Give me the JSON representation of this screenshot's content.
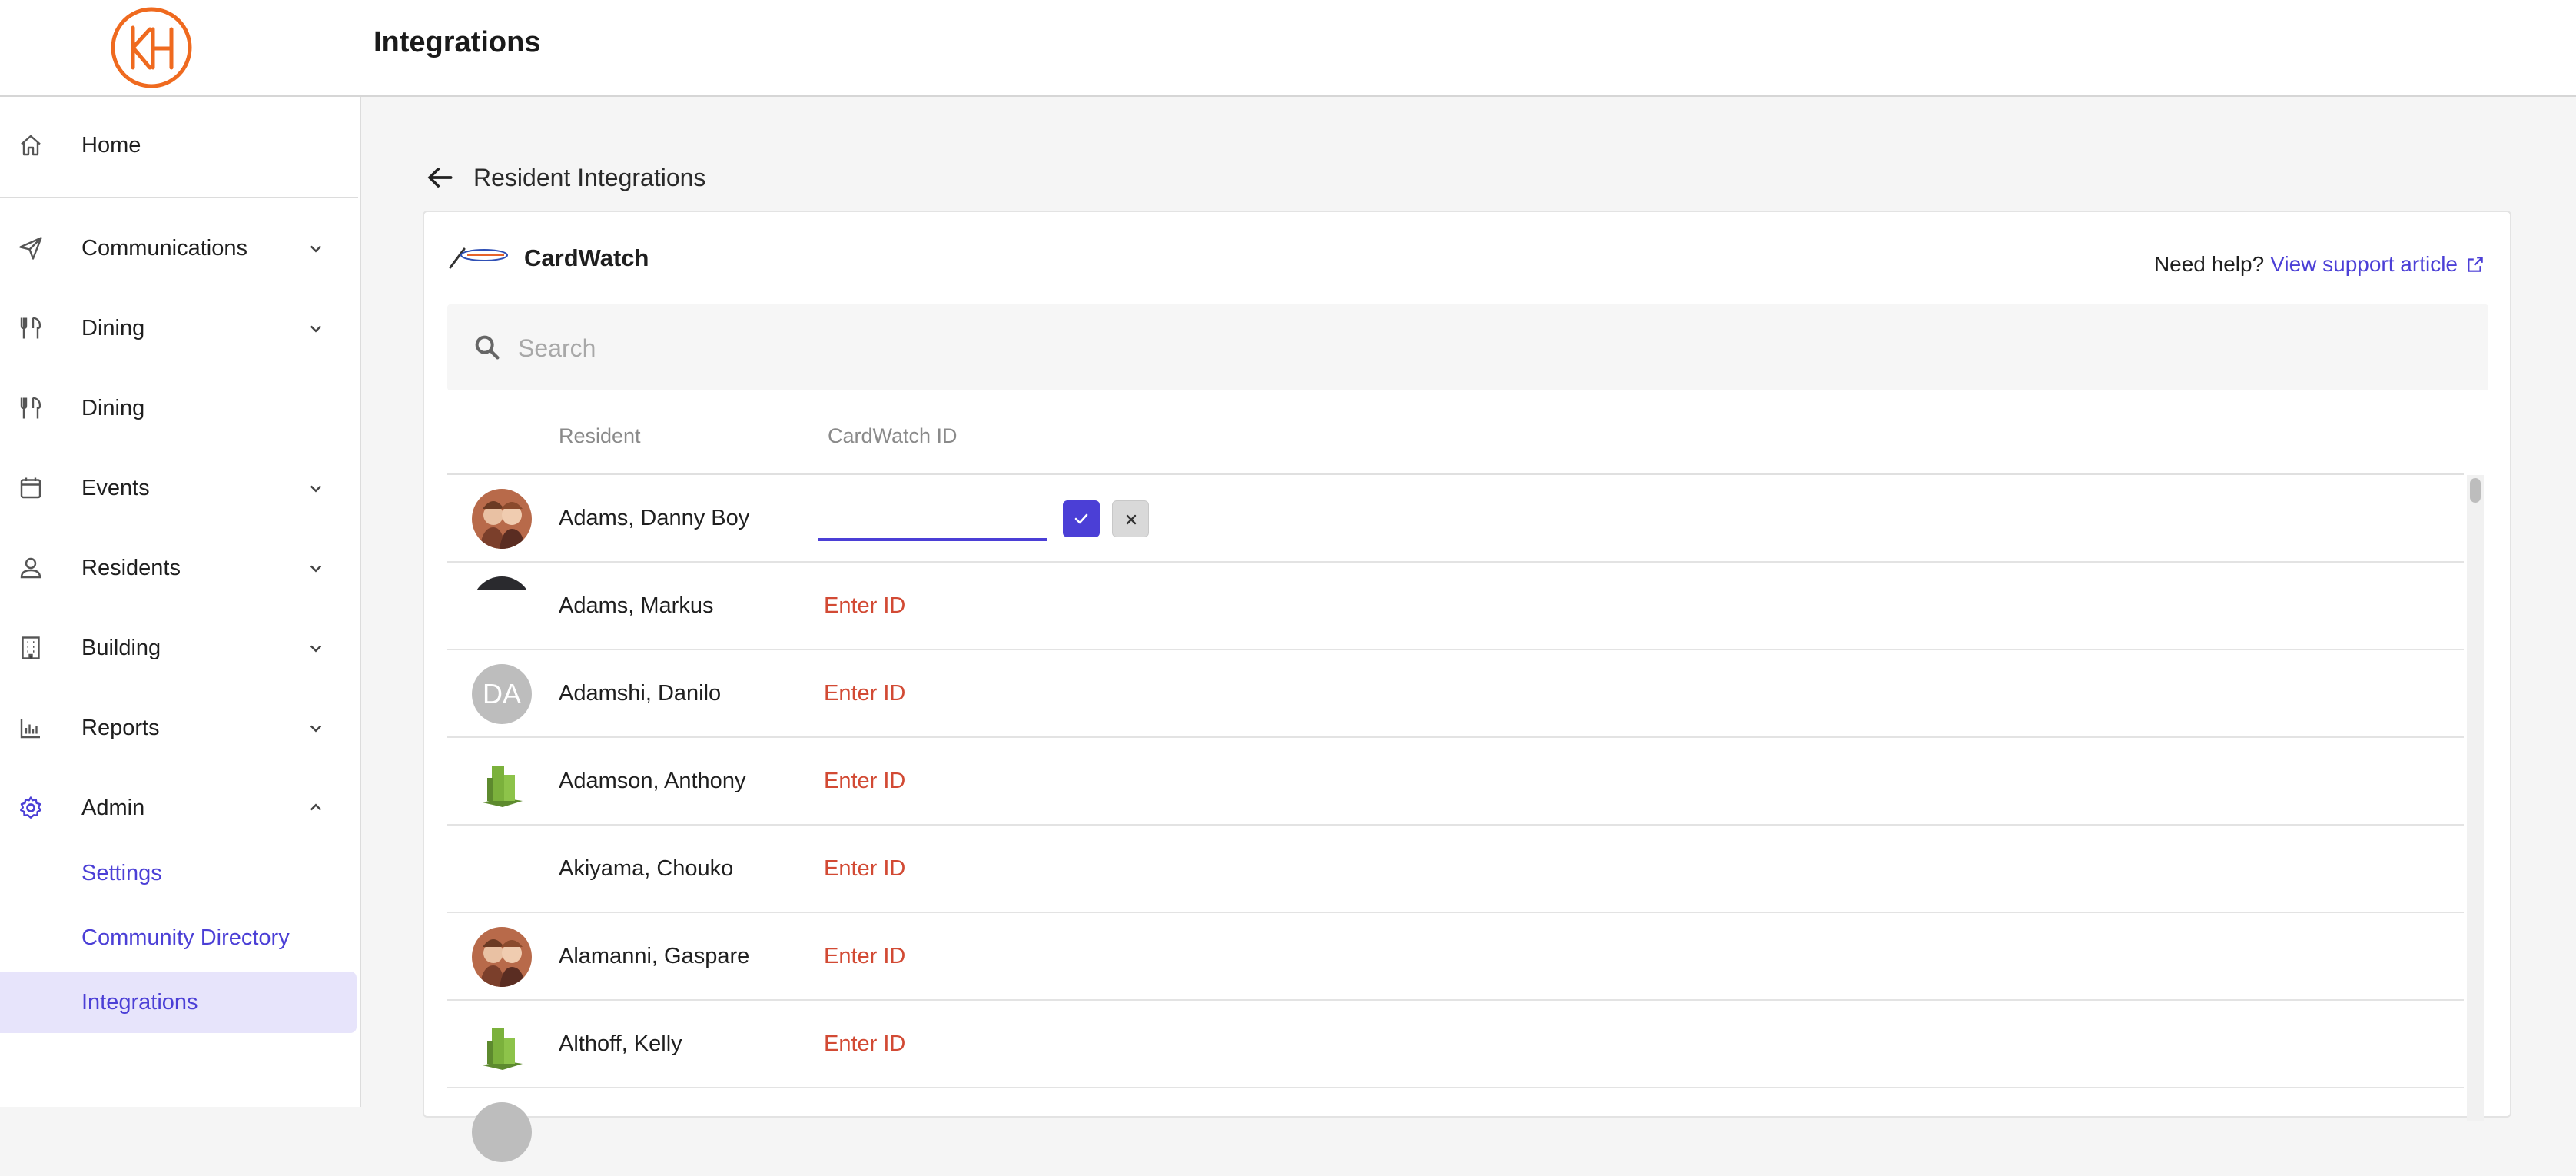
{
  "header": {
    "title": "Integrations"
  },
  "sidebar": {
    "items": [
      {
        "label": "Home",
        "icon": "home-icon",
        "expandable": false
      },
      {
        "label": "Communications",
        "icon": "send-icon",
        "expandable": true
      },
      {
        "label": "Dining",
        "icon": "dining-icon",
        "expandable": true
      },
      {
        "label": "Dining",
        "icon": "dining-icon",
        "expandable": false
      },
      {
        "label": "Events",
        "icon": "calendar-icon",
        "expandable": true
      },
      {
        "label": "Residents",
        "icon": "person-icon",
        "expandable": true
      },
      {
        "label": "Building",
        "icon": "building-icon",
        "expandable": true
      },
      {
        "label": "Reports",
        "icon": "bar-chart-icon",
        "expandable": true
      },
      {
        "label": "Admin",
        "icon": "gear-icon",
        "expandable": true,
        "expanded": true
      }
    ],
    "admin_sub": [
      {
        "label": "Settings"
      },
      {
        "label": "Community Directory"
      },
      {
        "label": "Integrations",
        "active": true
      }
    ],
    "accent_color": "#4b3fd6"
  },
  "main": {
    "back_title": "Resident Integrations",
    "integration_name": "CardWatch",
    "help_prefix": "Need help?",
    "help_link": "View support article",
    "search_placeholder": "Search",
    "columns": {
      "resident": "Resident",
      "id": "CardWatch ID"
    },
    "rows": [
      {
        "name": "Adams, Danny Boy",
        "avatar": "photo",
        "editing": true,
        "id_value": ""
      },
      {
        "name": "Adams, Markus",
        "avatar": "dark",
        "id_label": "Enter ID"
      },
      {
        "name": "Adamshi, Danilo",
        "avatar": "initials",
        "initials": "DA",
        "id_label": "Enter ID"
      },
      {
        "name": "Adamson, Anthony",
        "avatar": "building",
        "id_label": "Enter ID"
      },
      {
        "name": "Akiyama, Chouko",
        "avatar": "none",
        "id_label": "Enter ID"
      },
      {
        "name": "Alamanni, Gaspare",
        "avatar": "photo",
        "id_label": "Enter ID"
      },
      {
        "name": "Althoff, Kelly",
        "avatar": "building",
        "id_label": "Enter ID"
      }
    ],
    "link_color": "#d24a34"
  }
}
